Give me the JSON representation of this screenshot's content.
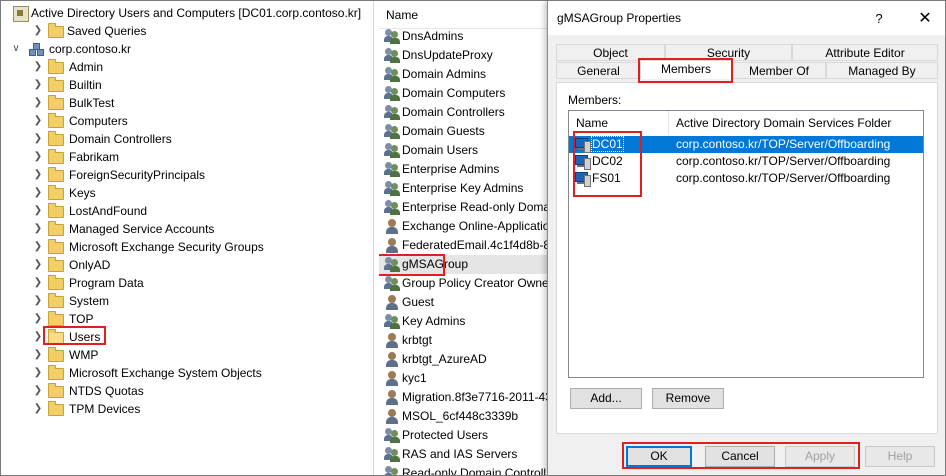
{
  "tree": {
    "root_label": "Active Directory Users and Computers [DC01.corp.contoso.kr]",
    "saved_queries": "Saved Queries",
    "domain": "corp.contoso.kr",
    "containers": [
      "Admin",
      "Builtin",
      "BulkTest",
      "Computers",
      "Domain Controllers",
      "Fabrikam",
      "ForeignSecurityPrincipals",
      "Keys",
      "LostAndFound",
      "Managed Service Accounts",
      "Microsoft Exchange Security Groups",
      "OnlyAD",
      "Program Data",
      "System",
      "TOP",
      "Users",
      "WMP",
      "Microsoft Exchange System Objects",
      "NTDS Quotas",
      "TPM Devices"
    ],
    "selected": "Users"
  },
  "list": {
    "header": "Name",
    "items": [
      {
        "name": "DnsAdmins",
        "icon": "group-icon"
      },
      {
        "name": "DnsUpdateProxy",
        "icon": "group-icon"
      },
      {
        "name": "Domain Admins",
        "icon": "group-icon"
      },
      {
        "name": "Domain Computers",
        "icon": "group-icon"
      },
      {
        "name": "Domain Controllers",
        "icon": "group-icon"
      },
      {
        "name": "Domain Guests",
        "icon": "group-icon"
      },
      {
        "name": "Domain Users",
        "icon": "group-icon"
      },
      {
        "name": "Enterprise Admins",
        "icon": "group-icon"
      },
      {
        "name": "Enterprise Key Admins",
        "icon": "group-icon"
      },
      {
        "name": "Enterprise Read-only Domai",
        "icon": "group-icon"
      },
      {
        "name": "Exchange Online-Applicatio",
        "icon": "user-icon"
      },
      {
        "name": "FederatedEmail.4c1f4d8b-8",
        "icon": "user-icon"
      },
      {
        "name": "gMSAGroup",
        "icon": "group-icon"
      },
      {
        "name": "Group Policy Creator Owne",
        "icon": "group-icon"
      },
      {
        "name": "Guest",
        "icon": "user-icon"
      },
      {
        "name": "Key Admins",
        "icon": "group-icon"
      },
      {
        "name": "krbtgt",
        "icon": "user-icon"
      },
      {
        "name": "krbtgt_AzureAD",
        "icon": "user-icon"
      },
      {
        "name": "kyc1",
        "icon": "user-icon"
      },
      {
        "name": "Migration.8f3e7716-2011-43",
        "icon": "user-icon"
      },
      {
        "name": "MSOL_6cf448c3339b",
        "icon": "user-icon"
      },
      {
        "name": "Protected Users",
        "icon": "group-icon"
      },
      {
        "name": "RAS and IAS Servers",
        "icon": "group-icon"
      },
      {
        "name": "Read-only Domain Controll",
        "icon": "group-icon"
      }
    ],
    "selected": "gMSAGroup"
  },
  "dialog": {
    "title": "gMSAGroup Properties",
    "help": "?",
    "close": "✕",
    "tabs_row1": [
      "Object",
      "Security",
      "Attribute Editor"
    ],
    "tabs_row2": [
      "General",
      "Members",
      "Member Of",
      "Managed By"
    ],
    "active_tab": "Members",
    "members_label": "Members:",
    "columns": [
      "Name",
      "Active Directory Domain Services Folder"
    ],
    "members": [
      {
        "name": "DC01",
        "folder": "corp.contoso.kr/TOP/Server/Offboarding",
        "selected": true
      },
      {
        "name": "DC02",
        "folder": "corp.contoso.kr/TOP/Server/Offboarding",
        "selected": false
      },
      {
        "name": "FS01",
        "folder": "corp.contoso.kr/TOP/Server/Offboarding",
        "selected": false
      }
    ],
    "add_button": "Add...",
    "remove_button": "Remove",
    "ok_button": "OK",
    "cancel_button": "Cancel",
    "apply_button": "Apply",
    "help_button": "Help"
  },
  "colors": {
    "selection": "#0078d7",
    "highlight_box": "#e02020",
    "folder": "#f2cf66"
  }
}
